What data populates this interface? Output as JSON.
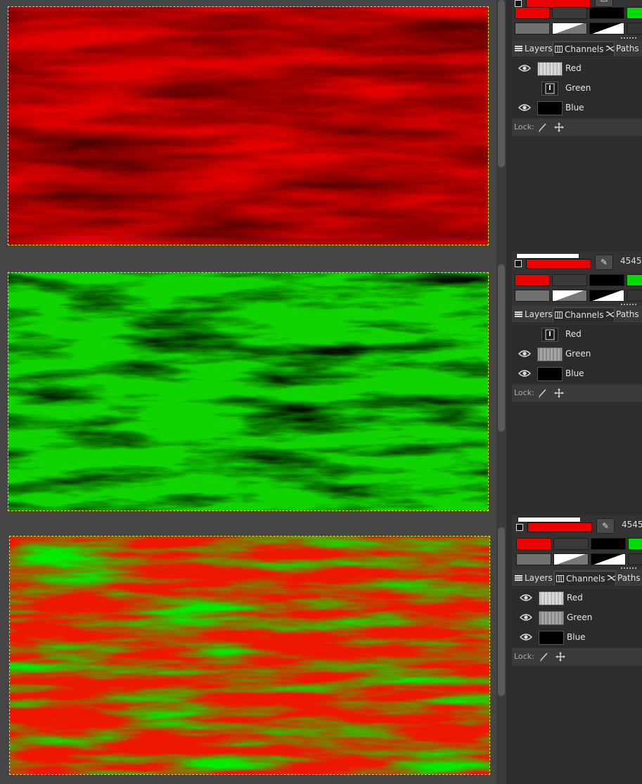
{
  "colors": {
    "red_fill": "#e60000",
    "green_fill": "#0bbf00",
    "orange_fill": "#e08000",
    "selection_outline": "#e8e800",
    "fg_color": "#ee0000",
    "swatches": [
      "#ee0000",
      "#3a3a3a",
      "#000000",
      "#00dd00",
      "#707070"
    ]
  },
  "panels": [
    {
      "size_value": "",
      "tabs": [
        "Layers",
        "Channels",
        "Paths"
      ],
      "active_tab": "Channels",
      "channels": [
        {
          "name": "Red",
          "visible": true,
          "thumb": "gray-texture"
        },
        {
          "name": "Green",
          "visible": false,
          "thumb": "empty-frame"
        },
        {
          "name": "Blue",
          "visible": true,
          "thumb": "black"
        }
      ],
      "lock_label": "Lock:"
    },
    {
      "size_value": "4545",
      "tabs": [
        "Layers",
        "Channels",
        "Paths"
      ],
      "active_tab": "Channels",
      "channels": [
        {
          "name": "Red",
          "visible": false,
          "thumb": "empty-frame"
        },
        {
          "name": "Green",
          "visible": true,
          "thumb": "gray-texture"
        },
        {
          "name": "Blue",
          "visible": true,
          "thumb": "black"
        }
      ],
      "lock_label": "Lock:"
    },
    {
      "size_value": "4545",
      "tabs": [
        "Layers",
        "Channels",
        "Paths"
      ],
      "active_tab": "Channels",
      "channels": [
        {
          "name": "Red",
          "visible": true,
          "thumb": "gray-texture"
        },
        {
          "name": "Green",
          "visible": true,
          "thumb": "gray-texture"
        },
        {
          "name": "Blue",
          "visible": true,
          "thumb": "black"
        }
      ],
      "lock_label": "Lock:"
    }
  ]
}
